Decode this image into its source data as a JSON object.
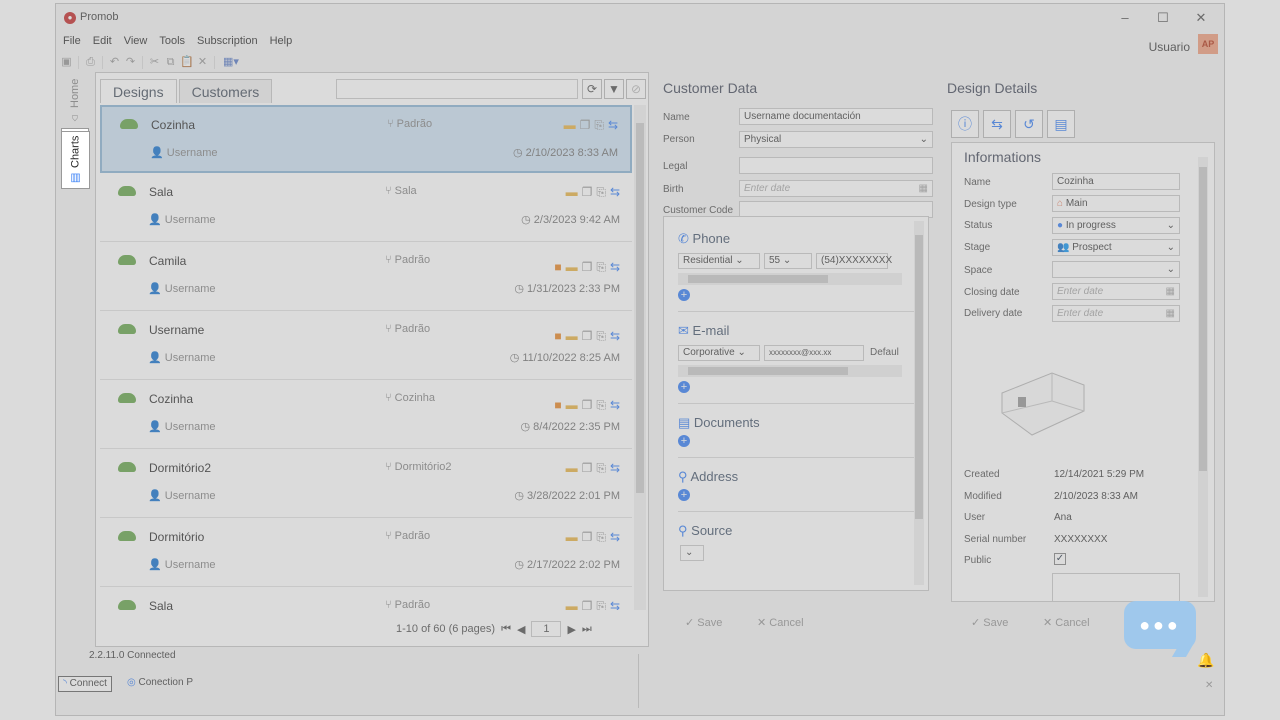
{
  "app": {
    "title": "Promob",
    "user": "Usuario",
    "avatar": "AP",
    "version_status": "2.2.11.0 Connected"
  },
  "menu": [
    "File",
    "Edit",
    "View",
    "Tools",
    "Subscription",
    "Help"
  ],
  "side_tabs": {
    "home": "Home",
    "charts": "Charts"
  },
  "designs": {
    "tabs": [
      "Designs",
      "Customers"
    ],
    "rows": [
      {
        "name": "Cozinha",
        "user": "Username",
        "type": "Padrão",
        "date": "2/10/2023 8:33 AM",
        "alert": false
      },
      {
        "name": "Sala",
        "user": "Username",
        "type": "Sala",
        "date": "2/3/2023 9:42 AM",
        "alert": false
      },
      {
        "name": "Camila",
        "user": "Username",
        "type": "Padrão",
        "date": "1/31/2023 2:33 PM",
        "alert": true
      },
      {
        "name": "Username",
        "user": "Username",
        "type": "Padrão",
        "date": "11/10/2022 8:25 AM",
        "alert": true
      },
      {
        "name": "Cozinha",
        "user": "Username",
        "type": "Cozinha",
        "date": "8/4/2022 2:35 PM",
        "alert": true
      },
      {
        "name": "Dormitório2",
        "user": "Username",
        "type": "Dormitório2",
        "date": "3/28/2022 2:01 PM",
        "alert": false
      },
      {
        "name": "Dormitório",
        "user": "Username",
        "type": "Padrão",
        "date": "2/17/2022 2:02 PM",
        "alert": false
      },
      {
        "name": "Sala",
        "user": "",
        "type": "Padrão",
        "date": "",
        "alert": false
      }
    ],
    "pager_text": "1-10 of 60 (6 pages)",
    "page": "1"
  },
  "customer": {
    "title": "Customer Data",
    "fields": {
      "name_label": "Name",
      "name_value": "Username documentación",
      "person_label": "Person",
      "person_value": "Physical",
      "legal_label": "Legal",
      "birth_label": "Birth",
      "birth_placeholder": "Enter date",
      "code_label": "Customer Code"
    },
    "phone": {
      "title": "Phone",
      "type": "Residential",
      "code": "55",
      "number": "(54)XXXXXXXX"
    },
    "email": {
      "title": "E-mail",
      "type": "Corporative",
      "value": "xxxxxxxx@xxx.xx",
      "default": "Defaul"
    },
    "documents": "Documents",
    "address": "Address",
    "source": "Source",
    "save": "Save",
    "cancel": "Cancel"
  },
  "details": {
    "title": "Design Details",
    "section": "Informations",
    "name_label": "Name",
    "name_value": "Cozinha",
    "design_type_label": "Design type",
    "design_type_value": "Main",
    "status_label": "Status",
    "status_value": "In progress",
    "stage_label": "Stage",
    "stage_value": "Prospect",
    "space_label": "Space",
    "closing_label": "Closing date",
    "closing_placeholder": "Enter date",
    "delivery_label": "Delivery date",
    "delivery_placeholder": "Enter date",
    "created_label": "Created",
    "created_value": "12/14/2021 5:29 PM",
    "modified_label": "Modified",
    "modified_value": "2/10/2023 8:33 AM",
    "user_label": "User",
    "user_value": "Ana",
    "serial_label": "Serial number",
    "serial_value": "XXXXXXXX",
    "public_label": "Public",
    "save": "Save",
    "cancel": "Cancel"
  },
  "statusbar": {
    "connect": "Connect",
    "connection": "Conection P"
  },
  "colors": {
    "accent": "#3b82f6",
    "cloud": "#6aa84f",
    "alert": "#e8892b",
    "brand": "#c62f2f"
  }
}
